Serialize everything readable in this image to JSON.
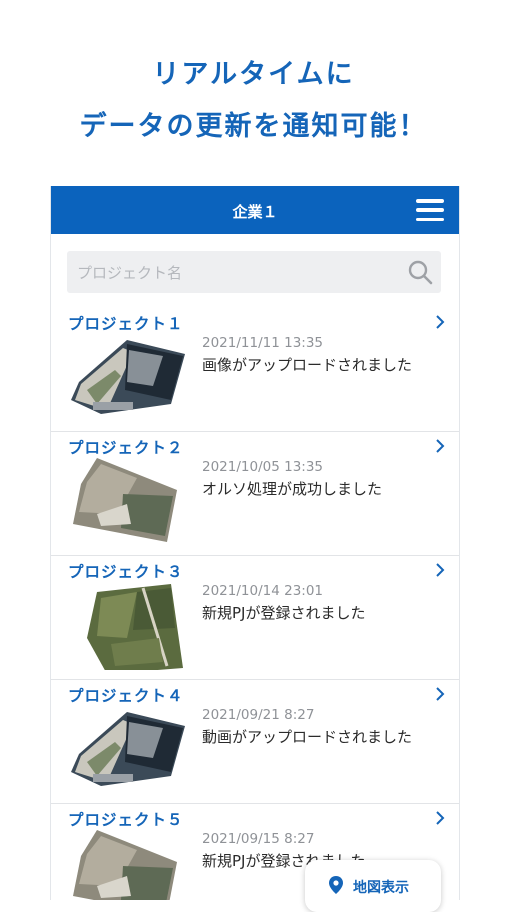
{
  "headline": {
    "line1": "リアルタイムに",
    "line2": "データの更新を通知可能！"
  },
  "colors": {
    "brand_blue": "#0b63bd",
    "title_blue": "#1565b8"
  },
  "appbar": {
    "title": "企業１",
    "menu_icon": "hamburger-menu-icon"
  },
  "search": {
    "placeholder": "プロジェクト名",
    "value": "",
    "icon": "search-icon"
  },
  "projects": [
    {
      "title": "プロジェクト１",
      "date": "2021/11/11 13:35",
      "message": "画像がアップロードされました"
    },
    {
      "title": "プロジェクト２",
      "date": "2021/10/05 13:35",
      "message": "オルソ処理が成功しました"
    },
    {
      "title": "プロジェクト３",
      "date": "2021/10/14 23:01",
      "message": "新規PJが登録されました"
    },
    {
      "title": "プロジェクト４",
      "date": "2021/09/21 8:27",
      "message": "動画がアップロードされました"
    },
    {
      "title": "プロジェクト５",
      "date": "2021/09/15 8:27",
      "message": "新規PJが登録されました"
    }
  ],
  "map_button": {
    "label": "地図表示",
    "icon": "map-pin-icon"
  }
}
